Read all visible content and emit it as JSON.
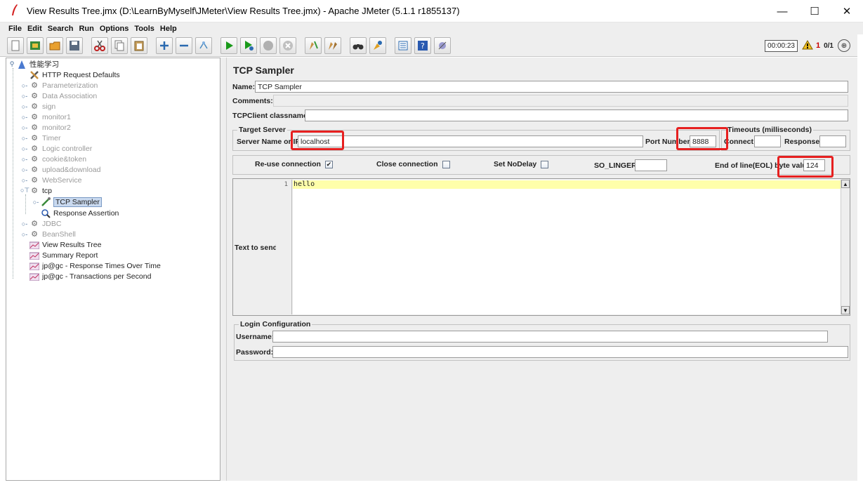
{
  "window": {
    "title": "View Results Tree.jmx (D:\\LearnByMyself\\JMeter\\View Results Tree.jmx) - Apache JMeter (5.1.1 r1855137)",
    "minimize": "—",
    "maximize": "☐",
    "close": "✕"
  },
  "menu": [
    "File",
    "Edit",
    "Search",
    "Run",
    "Options",
    "Tools",
    "Help"
  ],
  "status": {
    "timer": "00:00:23",
    "warnings": "1",
    "threads": "0/1"
  },
  "tree": {
    "root": "性能学习",
    "items": [
      {
        "label": "HTTP Request Defaults"
      },
      {
        "label": "Parameterization"
      },
      {
        "label": "Data Association"
      },
      {
        "label": "sign"
      },
      {
        "label": "monitor1"
      },
      {
        "label": "monitor2"
      },
      {
        "label": "Timer"
      },
      {
        "label": "Logic controller"
      },
      {
        "label": "cookie&token"
      },
      {
        "label": "upload&download"
      },
      {
        "label": "WebService"
      },
      {
        "label": "tcp"
      },
      {
        "label": "TCP Sampler"
      },
      {
        "label": "Response Assertion"
      },
      {
        "label": "JDBC"
      },
      {
        "label": "BeanShell"
      },
      {
        "label": "View Results Tree"
      },
      {
        "label": "Summary Report"
      },
      {
        "label": "jp@gc - Response Times Over Time"
      },
      {
        "label": "jp@gc - Transactions per Second"
      }
    ]
  },
  "sampler": {
    "heading": "TCP Sampler",
    "name_label": "Name:",
    "name_value": "TCP Sampler",
    "comments_label": "Comments:",
    "classname_label": "TCPClient classname:",
    "classname_value": "",
    "target_server_title": "Target Server",
    "server_label": "Server Name or IP:",
    "server_value": "localhost",
    "port_label": "Port Number:",
    "port_value": "8888",
    "timeouts_title": "Timeouts (milliseconds)",
    "connect_label": "Connect:",
    "connect_value": "",
    "response_label": "Response:",
    "response_value": "",
    "reuse_label": "Re-use connection",
    "close_label": "Close connection",
    "nodelay_label": "Set NoDelay",
    "solinger_label": "SO_LINGER:",
    "solinger_value": "",
    "eol_label": "End of line(EOL) byte value:",
    "eol_value": "124",
    "text_to_send_label": "Text to send",
    "line_number": "1",
    "text_to_send_value": "hello",
    "login_title": "Login Configuration",
    "username_label": "Username:",
    "username_value": "",
    "password_label": "Password:",
    "password_value": ""
  }
}
